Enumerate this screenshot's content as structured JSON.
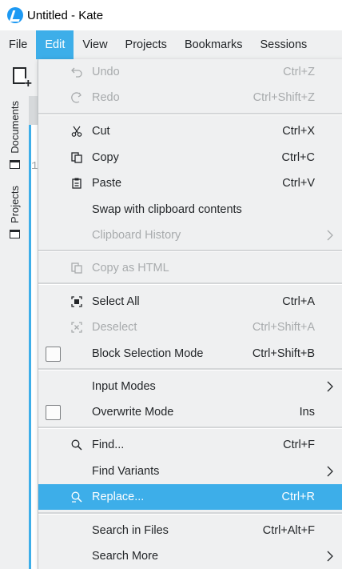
{
  "window": {
    "title": "Untitled  - Kate"
  },
  "menubar": {
    "items": [
      "File",
      "Edit",
      "View",
      "Projects",
      "Bookmarks",
      "Sessions"
    ]
  },
  "sidebar": {
    "tabs": [
      "Documents",
      "Projects"
    ]
  },
  "editor": {
    "line_number": "1"
  },
  "edit_menu": {
    "undo": {
      "label": "Undo",
      "shortcut": "Ctrl+Z"
    },
    "redo": {
      "label": "Redo",
      "shortcut": "Ctrl+Shift+Z"
    },
    "cut": {
      "label": "Cut",
      "shortcut": "Ctrl+X"
    },
    "copy": {
      "label": "Copy",
      "shortcut": "Ctrl+C"
    },
    "paste": {
      "label": "Paste",
      "shortcut": "Ctrl+V"
    },
    "swap": {
      "label": "Swap with clipboard contents"
    },
    "clipboard_history": {
      "label": "Clipboard History"
    },
    "copy_html": {
      "label": "Copy as HTML"
    },
    "select_all": {
      "label": "Select All",
      "shortcut": "Ctrl+A"
    },
    "deselect": {
      "label": "Deselect",
      "shortcut": "Ctrl+Shift+A"
    },
    "block_selection": {
      "label": "Block Selection Mode",
      "shortcut": "Ctrl+Shift+B"
    },
    "input_modes": {
      "label": "Input Modes"
    },
    "overwrite_mode": {
      "label": "Overwrite Mode",
      "shortcut": "Ins"
    },
    "find": {
      "label": "Find...",
      "shortcut": "Ctrl+F"
    },
    "find_variants": {
      "label": "Find Variants"
    },
    "replace": {
      "label": "Replace...",
      "shortcut": "Ctrl+R"
    },
    "search_in_files": {
      "label": "Search in Files",
      "shortcut": "Ctrl+Alt+F"
    },
    "search_more": {
      "label": "Search More"
    }
  },
  "colors": {
    "accent": "#3daee9",
    "menu_bg": "#eff0f1",
    "disabled_text": "#a8abad"
  }
}
